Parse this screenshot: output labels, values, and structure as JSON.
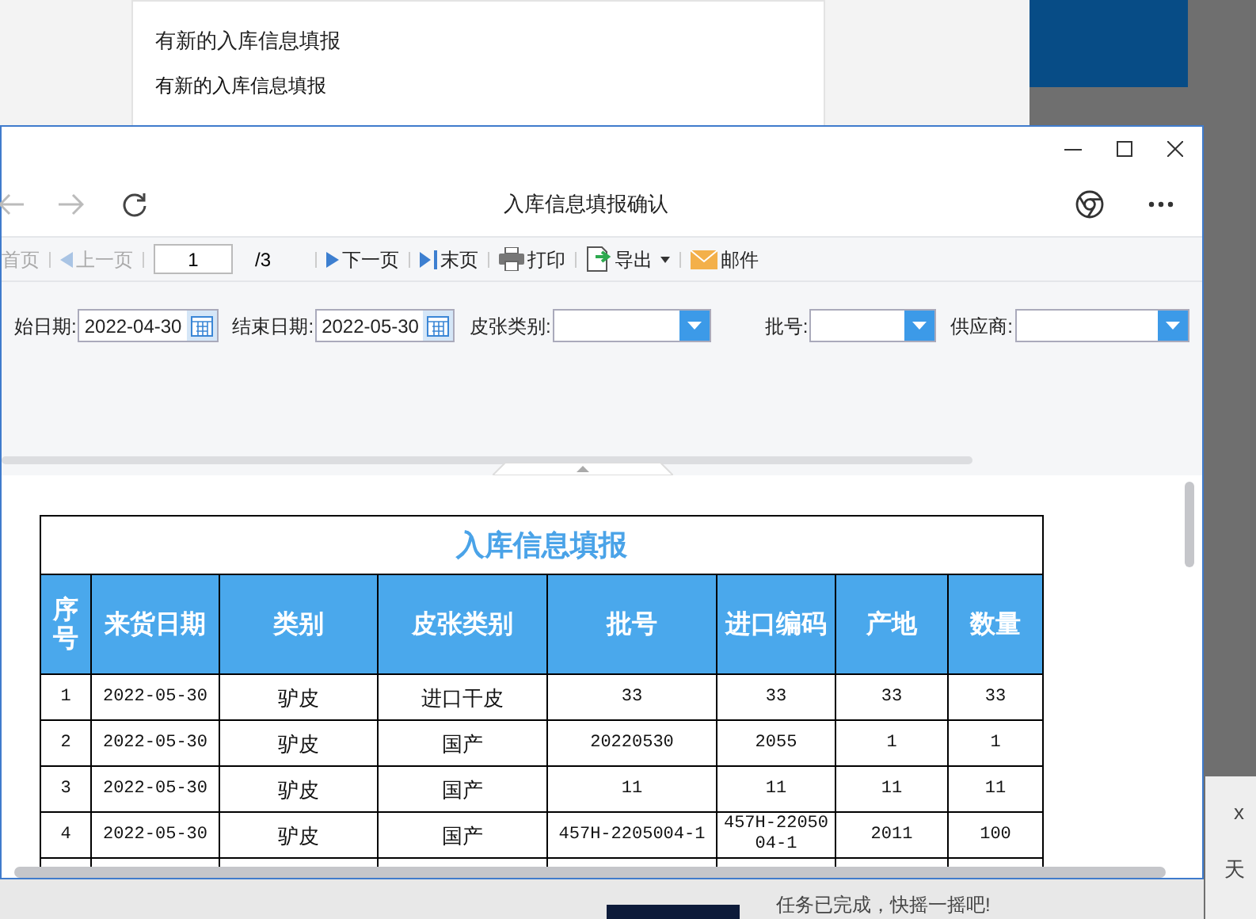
{
  "background": {
    "notice_title": "有新的入库信息填报",
    "notice_text": "有新的入库信息填报",
    "status_text": "任务已完成，快摇一摇吧!",
    "side_close": "x",
    "side_char": "天"
  },
  "window": {
    "title": "入库信息填报确认"
  },
  "toolbar": {
    "items": [
      {
        "kind": "first",
        "label": "首页",
        "disabled": true
      },
      {
        "kind": "prev",
        "label": "上一页",
        "disabled": true
      },
      {
        "kind": "page",
        "value": "1",
        "total": "/3"
      },
      {
        "kind": "next",
        "label": "下一页",
        "disabled": false
      },
      {
        "kind": "last",
        "label": "末页",
        "disabled": false
      },
      {
        "kind": "print",
        "label": "打印",
        "disabled": false
      },
      {
        "kind": "export",
        "label": "导出",
        "disabled": false
      },
      {
        "kind": "mail",
        "label": "邮件",
        "disabled": false
      }
    ]
  },
  "filters": [
    {
      "kind": "date",
      "label": "始日期:",
      "value": "2022-04-30"
    },
    {
      "kind": "date",
      "label": "结束日期:",
      "value": "2022-05-30"
    },
    {
      "kind": "select",
      "label": "皮张类别:"
    },
    {
      "kind": "select",
      "label": "批号:"
    },
    {
      "kind": "select",
      "label": "供应商:"
    }
  ],
  "report": {
    "title": "入库信息填报",
    "columns": [
      "序号",
      "来货日期",
      "类别",
      "皮张类别",
      "批号",
      "进口编码",
      "产地",
      "数量"
    ],
    "rows": [
      [
        "1",
        "2022-05-30",
        "驴皮",
        "进口干皮",
        "33",
        "33",
        "33",
        "33"
      ],
      [
        "2",
        "2022-05-30",
        "驴皮",
        "国产",
        "20220530",
        "2055",
        "1",
        "1"
      ],
      [
        "3",
        "2022-05-30",
        "驴皮",
        "国产",
        "11",
        "11",
        "11",
        "11"
      ],
      [
        "4",
        "2022-05-30",
        "驴皮",
        "国产",
        "457H-2205004-1",
        "457H-2205004-1",
        "2011",
        "100"
      ]
    ]
  }
}
